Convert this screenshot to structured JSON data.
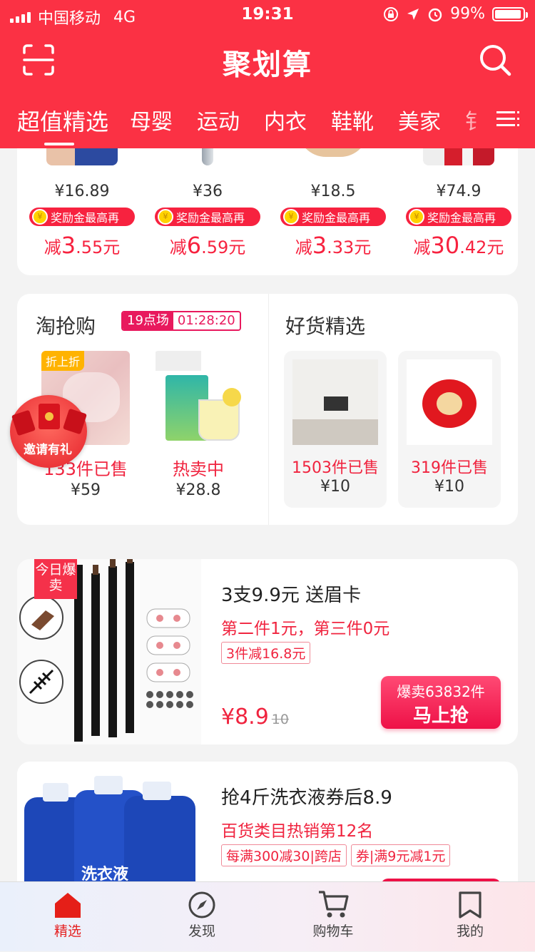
{
  "status_bar": {
    "carrier": "中国移动",
    "network": "4G",
    "time": "19:31",
    "battery": "99%"
  },
  "header": {
    "title": "聚划算"
  },
  "tabs": [
    "超值精选",
    "母婴",
    "运动",
    "内衣",
    "鞋靴",
    "美家",
    "钅"
  ],
  "rebate_products": [
    {
      "price": "¥16.89",
      "rebate_label": "奖励金最高再",
      "prefix": "减",
      "big": "3",
      "small": ".55元"
    },
    {
      "price": "¥36",
      "rebate_label": "奖励金最高再",
      "prefix": "减",
      "big": "6",
      "small": ".59元"
    },
    {
      "price": "¥18.5",
      "rebate_label": "奖励金最高再",
      "prefix": "减",
      "big": "3",
      "small": ".33元"
    },
    {
      "price": "¥74.9",
      "rebate_label": "奖励金最高再",
      "prefix": "减",
      "big": "30",
      "small": ".42元"
    }
  ],
  "taoqiang": {
    "title": "淘抢购",
    "session": "19点场",
    "countdown": "01:28:20",
    "items": [
      {
        "tag": "折上折",
        "sold": "133件已售",
        "price": "¥59"
      },
      {
        "sold": "热卖中",
        "price": "¥28.8"
      }
    ]
  },
  "haohuo": {
    "title": "好货精选",
    "items": [
      {
        "sold": "1503件已售",
        "price": "¥10"
      },
      {
        "sold": "319件已售",
        "price": "¥10"
      }
    ]
  },
  "invite_badge": {
    "label": "邀请有礼"
  },
  "products": [
    {
      "today_tag": "今日爆卖",
      "title": "3支9.9元 送眉卡",
      "desc": "第二件1元，第三件0元",
      "tags": [
        "3件减16.8元"
      ],
      "price": "¥8.9",
      "orig_price": "10",
      "sold_count": "爆卖63832件",
      "buy_label": "马上抢"
    },
    {
      "title": "抢4斤洗衣液券后8.9",
      "desc": "百货类目热销第12名",
      "tags": [
        "每满300减30|跨店",
        "券|满9元减1元"
      ],
      "img_text": "洗衣液"
    }
  ],
  "tabbar": [
    {
      "label": "精选",
      "icon": "home-icon",
      "active": true
    },
    {
      "label": "发现",
      "icon": "compass-icon",
      "active": false
    },
    {
      "label": "购物车",
      "icon": "cart-icon",
      "active": false
    },
    {
      "label": "我的",
      "icon": "bookmark-icon",
      "active": false
    }
  ],
  "colors": {
    "brand": "#fb3144",
    "price_red": "#f0243f",
    "accent_pink": "#e8195d"
  }
}
